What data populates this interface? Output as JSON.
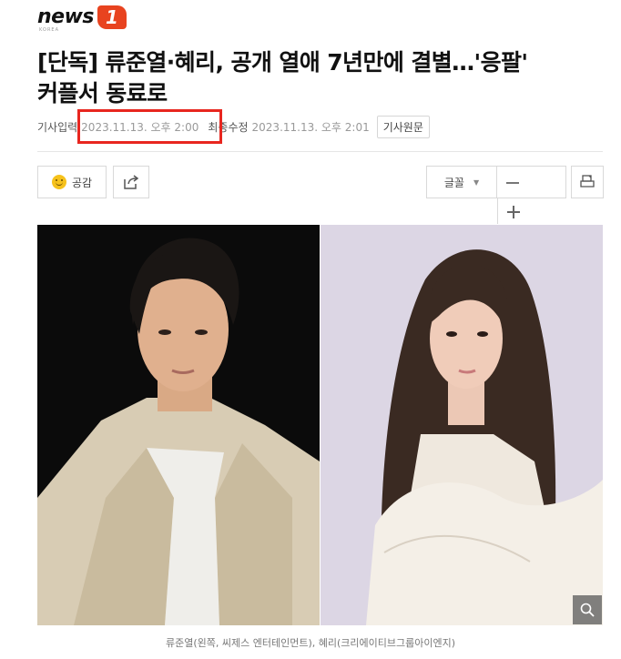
{
  "logo": {
    "brand": "news",
    "badge": "1",
    "sub": "KOREA"
  },
  "article": {
    "headline_line1": "[단독] 류준열·혜리, 공개 열애 7년만에 결별…'응팔'",
    "headline_line2": "커플서 동료로",
    "meta": {
      "published_label": "기사입력",
      "published_value": "2023.11.13. 오후 2:00",
      "modified_label": "최종수정",
      "modified_value": "2023.11.13. 오후 2:01",
      "original_button": "기사원문"
    },
    "toolbar": {
      "like_label": "공감",
      "font_label": "글꼴"
    },
    "caption": "류준열(왼쪽, 씨제스 엔터테인먼트), 혜리(크리에이티브그룹아이엔지)"
  },
  "colors": {
    "brand_orange": "#e8431f",
    "highlight_red": "#e8261f"
  },
  "icons": [
    "smile-icon",
    "share-icon",
    "caret-down-icon",
    "minus-icon",
    "plus-icon",
    "print-icon",
    "magnify-icon"
  ]
}
